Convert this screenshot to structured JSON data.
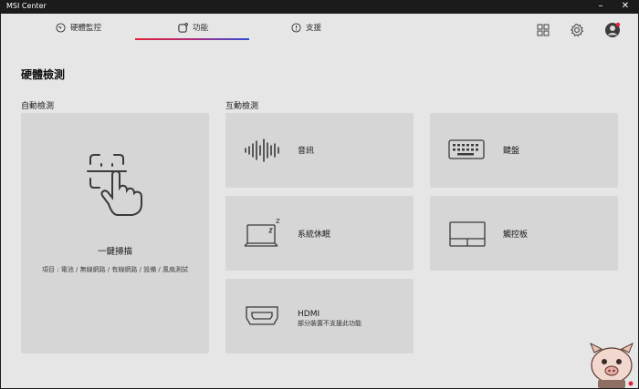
{
  "window": {
    "title": "MSI Center",
    "minimize": "–",
    "close": "✕"
  },
  "nav": {
    "tabs": [
      {
        "label": "硬體監控",
        "icon": "monitor-dial-icon"
      },
      {
        "label": "功能",
        "icon": "feature-icon",
        "active": true
      },
      {
        "label": "支援",
        "icon": "support-icon"
      }
    ],
    "icons": [
      "grid-icon",
      "gear-icon",
      "avatar"
    ]
  },
  "page": {
    "title": "硬體檢測"
  },
  "sections": {
    "auto": "自動檢測",
    "interactive": "互動檢測"
  },
  "auto_card": {
    "label": "一鍵掃描",
    "items": "項目 : 電池 / 無線網路 / 有線網路 / 設備 / 風扇測試",
    "icon": "face-scan-touch-icon"
  },
  "interactive_cards": [
    {
      "label": "音訊",
      "icon": "audio-wave-icon"
    },
    {
      "label": "鍵盤",
      "icon": "keyboard-icon"
    },
    {
      "label": "系統休眠",
      "icon": "laptop-sleep-icon"
    },
    {
      "label": "觸控板",
      "icon": "touchpad-icon"
    },
    {
      "label": "HDMI",
      "sub": "部分裝置不支援此功能",
      "icon": "hdmi-icon"
    }
  ],
  "colors": {
    "accent_red": "#e0223a",
    "accent_blue": "#2a4fd6",
    "background": "#e6e6e6",
    "card": "#d6d6d6"
  }
}
